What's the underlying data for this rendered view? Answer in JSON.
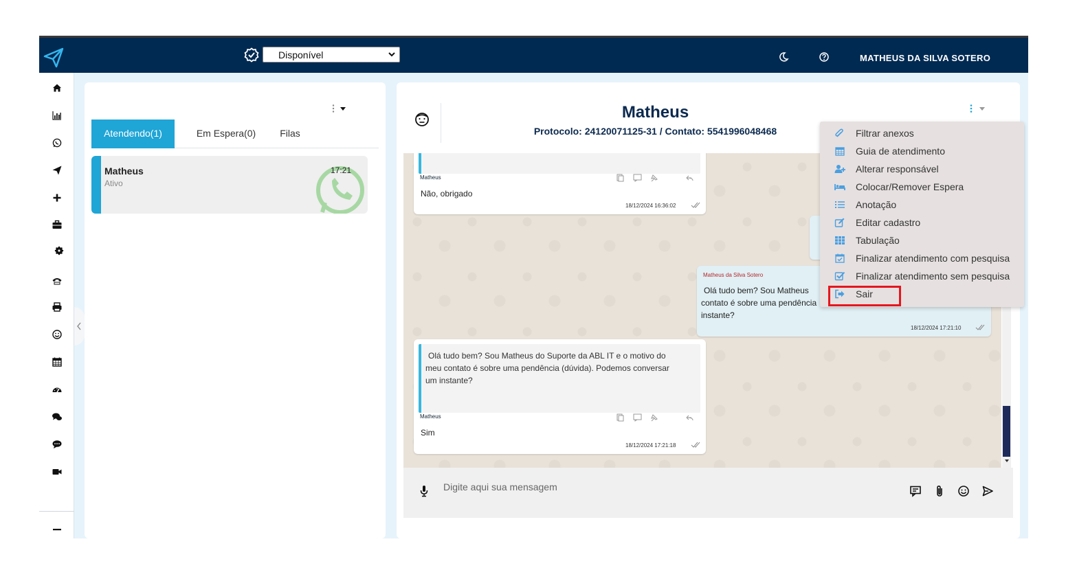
{
  "colors": {
    "topbar": "#012a52",
    "accent": "#1fa5d6",
    "highlight": "#e5161e",
    "title": "#0c2a4f"
  },
  "header": {
    "status_value": "Disponível",
    "user_name": "MATHEUS DA SILVA SOTERO"
  },
  "sidebar": {
    "icons": [
      "home-icon",
      "bar-chart-icon",
      "whatsapp-icon",
      "send-icon",
      "plus-icon",
      "briefcase-icon",
      "gear-icon",
      "phone-icon",
      "printer-icon",
      "smile-icon",
      "calendar-icon",
      "dashboard-icon",
      "chat-bubbles-icon",
      "comment-icon",
      "video-icon",
      "minus-icon"
    ]
  },
  "left_panel": {
    "tabs": [
      {
        "label": "Atendendo(1)",
        "active": true
      },
      {
        "label": "Em Espera(0)",
        "active": false
      },
      {
        "label": "Filas",
        "active": false
      }
    ],
    "conversation": {
      "name": "Matheus",
      "status": "Ativo",
      "time": "17:21"
    }
  },
  "chat": {
    "title": "Matheus",
    "subtitle": "Protocolo: 24120071125-31 / Contato: 5541996048468",
    "messages": [
      {
        "sender": "Matheus",
        "text": "Não, obrigado",
        "timestamp": "18/12/2024 16:36:02"
      },
      {
        "sender": "Matheus da Silva Sotero",
        "text_line1": "Olá tudo bem? Sou Matheus",
        "text_line2": "contato é sobre uma pendência",
        "text_line3": "instante?",
        "timestamp": "18/12/2024 17:21:10"
      },
      {
        "sender": "Matheus",
        "quote_line1": "Olá tudo bem? Sou Matheus  do Suporte da ABL IT e o motivo do",
        "quote_line2": "meu contato é sobre uma pendência (dúvida). Podemos conversar",
        "quote_line3": "um instante?",
        "text": "Sim",
        "timestamp": "18/12/2024 17:21:18"
      }
    ],
    "input_placeholder": "Digite aqui sua mensagem"
  },
  "dropdown_menu": {
    "items": [
      {
        "label": "Filtrar anexos",
        "icon": "paperclip-icon"
      },
      {
        "label": "Guia de atendimento",
        "icon": "calendar-icon"
      },
      {
        "label": "Alterar responsável",
        "icon": "user-plus-icon"
      },
      {
        "label": "Colocar/Remover Espera",
        "icon": "bed-icon"
      },
      {
        "label": "Anotação",
        "icon": "list-icon"
      },
      {
        "label": "Editar cadastro",
        "icon": "edit-icon"
      },
      {
        "label": "Tabulação",
        "icon": "grid-icon"
      },
      {
        "label": "Finalizar atendimento com pesquisa",
        "icon": "calendar-check-icon"
      },
      {
        "label": "Finalizar atendimento sem pesquisa",
        "icon": "check-square-icon"
      },
      {
        "label": "Sair",
        "icon": "sign-out-icon"
      }
    ]
  }
}
